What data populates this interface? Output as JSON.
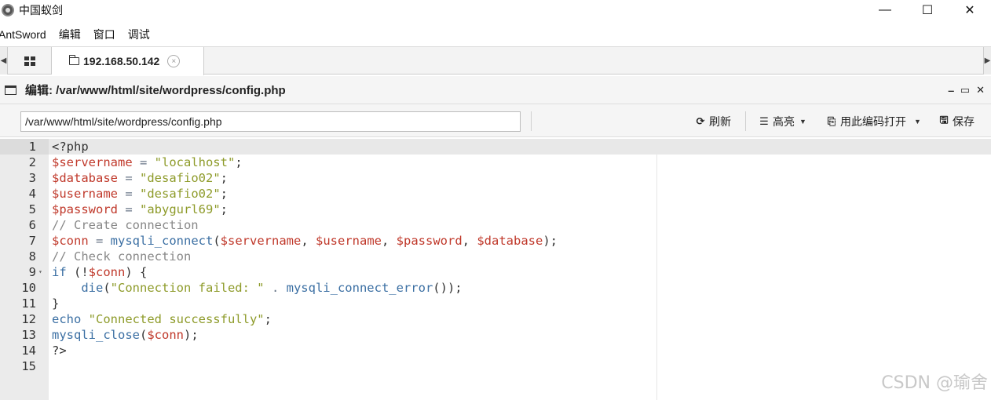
{
  "window": {
    "title": "中国蚁剑",
    "minimize": "—",
    "maximize": "☐",
    "close": "✕"
  },
  "menu": [
    "AntSword",
    "编辑",
    "窗口",
    "调试"
  ],
  "tabs": {
    "active_label": "192.168.50.142",
    "close_glyph": "×"
  },
  "panel": {
    "title": "编辑: /var/www/html/site/wordpress/config.php",
    "controls": [
      "‒",
      "▭",
      "✕"
    ]
  },
  "toolbar": {
    "path_value": "/var/www/html/site/wordpress/config.php",
    "refresh_label": "刷新",
    "highlight_label": "高亮",
    "open_with_encoding_label": "用此编码打开",
    "save_label": "保存"
  },
  "editor": {
    "active_line": 1,
    "lines": [
      {
        "n": "1",
        "tokens": [
          {
            "c": "t-tag",
            "t": "<?php"
          }
        ]
      },
      {
        "n": "2",
        "tokens": [
          {
            "c": "t-var",
            "t": "$servername"
          },
          {
            "c": "t-op",
            "t": " = "
          },
          {
            "c": "t-str",
            "t": "\"localhost\""
          },
          {
            "c": "t-punct",
            "t": ";"
          }
        ]
      },
      {
        "n": "3",
        "tokens": [
          {
            "c": "t-var",
            "t": "$database"
          },
          {
            "c": "t-op",
            "t": " = "
          },
          {
            "c": "t-str",
            "t": "\"desafio02\""
          },
          {
            "c": "t-punct",
            "t": ";"
          }
        ]
      },
      {
        "n": "4",
        "tokens": [
          {
            "c": "t-var",
            "t": "$username"
          },
          {
            "c": "t-op",
            "t": " = "
          },
          {
            "c": "t-str",
            "t": "\"desafio02\""
          },
          {
            "c": "t-punct",
            "t": ";"
          }
        ]
      },
      {
        "n": "5",
        "tokens": [
          {
            "c": "t-var",
            "t": "$password"
          },
          {
            "c": "t-op",
            "t": " = "
          },
          {
            "c": "t-str",
            "t": "\"abygurl69\""
          },
          {
            "c": "t-punct",
            "t": ";"
          }
        ]
      },
      {
        "n": "6",
        "tokens": [
          {
            "c": "t-cmt",
            "t": "// Create connection"
          }
        ]
      },
      {
        "n": "7",
        "tokens": [
          {
            "c": "t-var",
            "t": "$conn"
          },
          {
            "c": "t-op",
            "t": " = "
          },
          {
            "c": "t-fn",
            "t": "mysqli_connect"
          },
          {
            "c": "t-punct",
            "t": "("
          },
          {
            "c": "t-var",
            "t": "$servername"
          },
          {
            "c": "t-punct",
            "t": ", "
          },
          {
            "c": "t-var",
            "t": "$username"
          },
          {
            "c": "t-punct",
            "t": ", "
          },
          {
            "c": "t-var",
            "t": "$password"
          },
          {
            "c": "t-punct",
            "t": ", "
          },
          {
            "c": "t-var",
            "t": "$database"
          },
          {
            "c": "t-punct",
            "t": ");"
          }
        ]
      },
      {
        "n": "8",
        "tokens": [
          {
            "c": "t-cmt",
            "t": "// Check connection"
          }
        ]
      },
      {
        "n": "9",
        "fold": true,
        "tokens": [
          {
            "c": "t-kw",
            "t": "if"
          },
          {
            "c": "t-punct",
            "t": " (!"
          },
          {
            "c": "t-var",
            "t": "$conn"
          },
          {
            "c": "t-punct",
            "t": ") {"
          }
        ]
      },
      {
        "n": "10",
        "tokens": [
          {
            "c": "t-punct",
            "t": "    "
          },
          {
            "c": "t-call",
            "t": "die"
          },
          {
            "c": "t-punct",
            "t": "("
          },
          {
            "c": "t-str",
            "t": "\"Connection failed: \""
          },
          {
            "c": "t-op",
            "t": " . "
          },
          {
            "c": "t-fn",
            "t": "mysqli_connect_error"
          },
          {
            "c": "t-punct",
            "t": "());"
          }
        ]
      },
      {
        "n": "11",
        "tokens": [
          {
            "c": "t-punct",
            "t": "}"
          }
        ]
      },
      {
        "n": "12",
        "tokens": [
          {
            "c": "t-kw",
            "t": "echo"
          },
          {
            "c": "t-punct",
            "t": " "
          },
          {
            "c": "t-str",
            "t": "\"Connected successfully\""
          },
          {
            "c": "t-punct",
            "t": ";"
          }
        ]
      },
      {
        "n": "13",
        "tokens": [
          {
            "c": "t-fn",
            "t": "mysqli_close"
          },
          {
            "c": "t-punct",
            "t": "("
          },
          {
            "c": "t-var",
            "t": "$conn"
          },
          {
            "c": "t-punct",
            "t": ");"
          }
        ]
      },
      {
        "n": "14",
        "tokens": [
          {
            "c": "t-tag",
            "t": "?>"
          }
        ]
      },
      {
        "n": "15",
        "tokens": []
      }
    ]
  },
  "watermark": "CSDN @瑜舍",
  "colors": {
    "variable": "#c0392b",
    "string": "#8e9b2a",
    "keyword": "#3b6fa3",
    "comment": "#888888"
  }
}
